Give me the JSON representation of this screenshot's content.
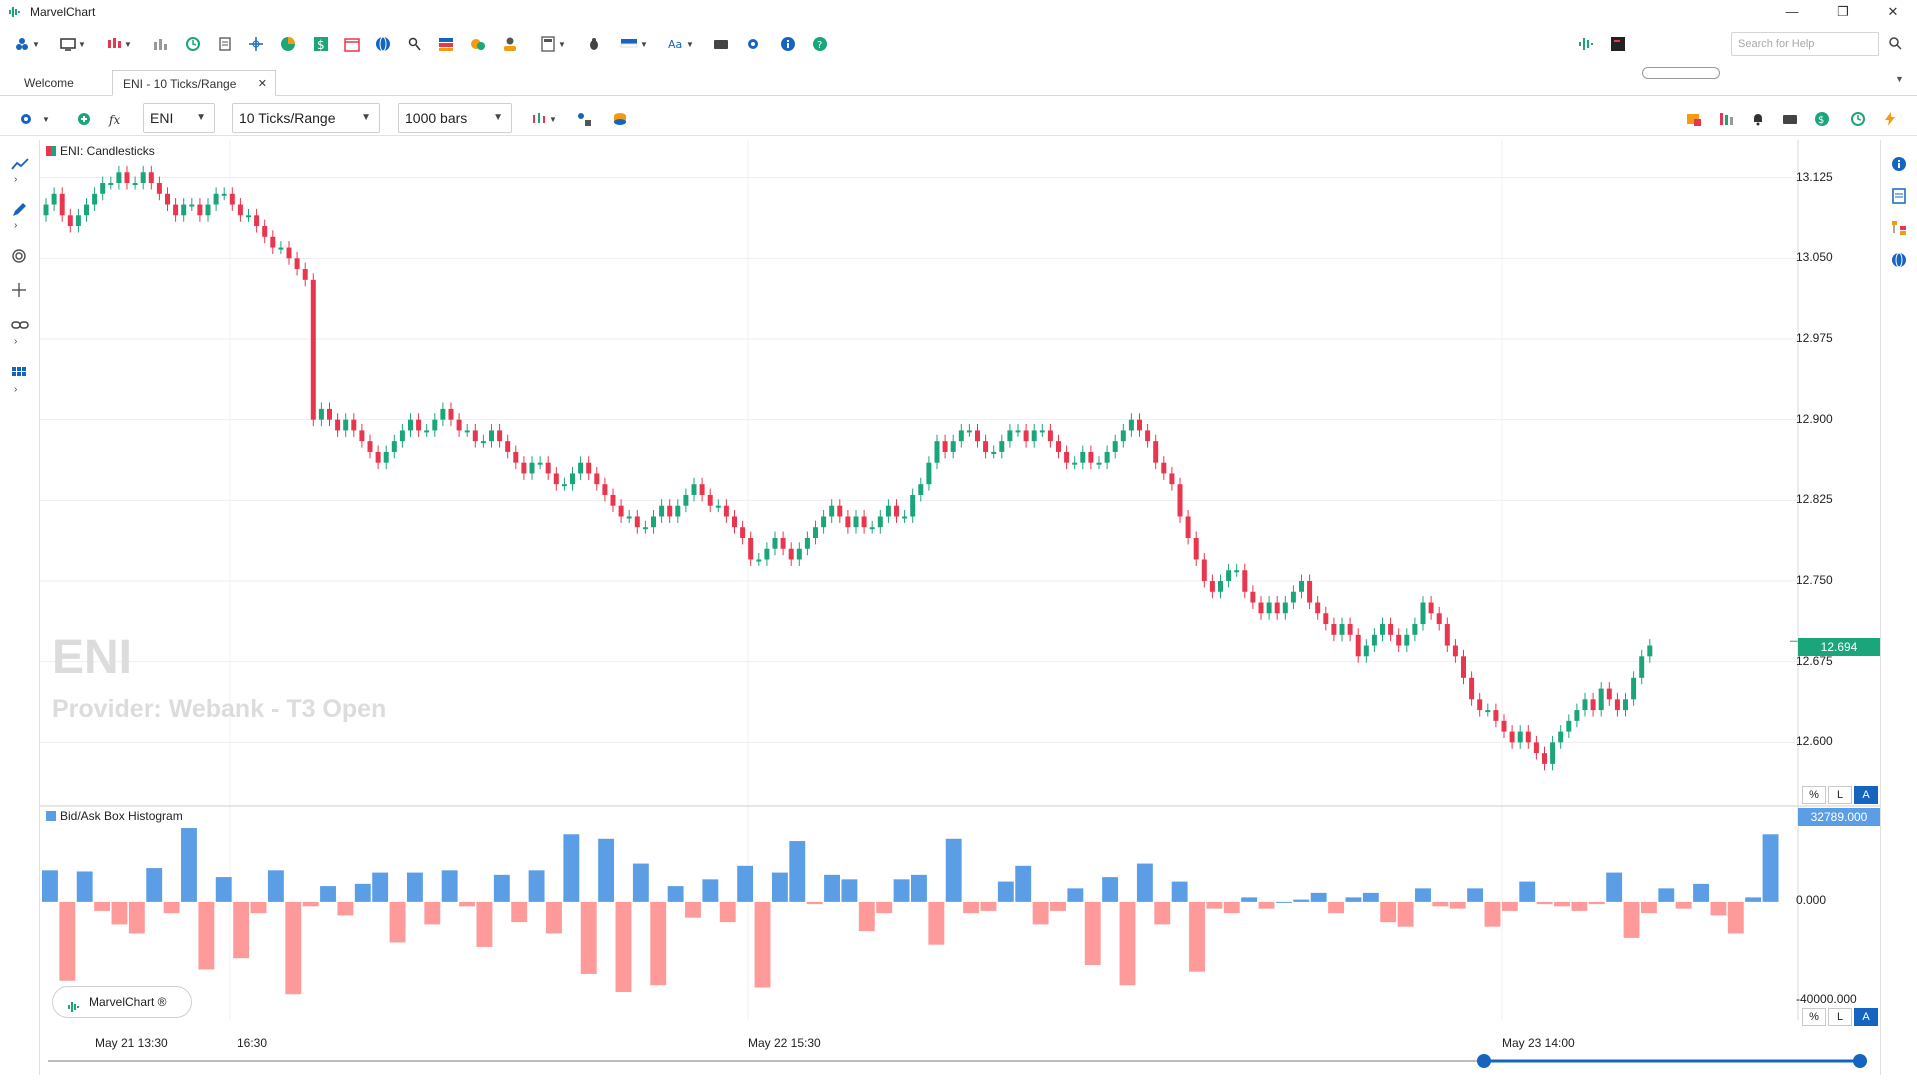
{
  "window": {
    "title": "MarvelChart",
    "minimize": "—",
    "maximize": "❐",
    "close": "✕"
  },
  "help_search": {
    "placeholder": "Search for Help"
  },
  "tabs": [
    {
      "label": "Welcome"
    },
    {
      "label": "ENI - 10 Ticks/Range",
      "close": "✕"
    }
  ],
  "chart_toolbar": {
    "symbol": "ENI",
    "period": "10 Ticks/Range",
    "bars": "1000 bars"
  },
  "price_panel": {
    "title": "ENI: Candlesticks",
    "watermark_symbol": "ENI",
    "watermark_provider": "Provider: Webank - T3 Open",
    "last_price": "12.694"
  },
  "price_axis": [
    "13.125",
    "13.050",
    "12.975",
    "12.900",
    "12.825",
    "12.750",
    "12.675",
    "12.600"
  ],
  "hist_panel": {
    "title": "Bid/Ask Box Histogram",
    "max_label": "32789.000",
    "zero_label": "0.000",
    "min_label": "-40000.000"
  },
  "scale_buttons": [
    "%",
    "L",
    "A"
  ],
  "time_axis": [
    "May 21 13:30",
    "16:30",
    "May 22 15:30",
    "May 23 14:00"
  ],
  "brand_badge": "MarvelChart ®",
  "colors": {
    "up": "#1ba57a",
    "down": "#e8364e",
    "hist_pos": "#5b9ee6",
    "hist_neg": "#ff9a9a",
    "accent": "#1565c0"
  },
  "chart_data": [
    {
      "type": "candlestick",
      "title": "ENI: Candlesticks",
      "y_ticks": [
        13.125,
        13.05,
        12.975,
        12.9,
        12.825,
        12.75,
        12.675,
        12.6
      ],
      "ylim": [
        12.565,
        13.16
      ],
      "last": 12.694,
      "closes": [
        13.1,
        13.11,
        13.09,
        13.08,
        13.09,
        13.1,
        13.11,
        13.12,
        13.12,
        13.13,
        13.12,
        13.12,
        13.13,
        13.12,
        13.11,
        13.1,
        13.09,
        13.1,
        13.1,
        13.09,
        13.1,
        13.11,
        13.11,
        13.1,
        13.09,
        13.09,
        13.08,
        13.07,
        13.06,
        13.06,
        13.05,
        13.04,
        13.03,
        12.9,
        12.91,
        12.9,
        12.89,
        12.9,
        12.89,
        12.88,
        12.87,
        12.86,
        12.87,
        12.88,
        12.89,
        12.9,
        12.89,
        12.89,
        12.9,
        12.91,
        12.9,
        12.89,
        12.89,
        12.88,
        12.88,
        12.89,
        12.88,
        12.87,
        12.86,
        12.85,
        12.86,
        12.86,
        12.85,
        12.84,
        12.84,
        12.85,
        12.86,
        12.85,
        12.84,
        12.83,
        12.82,
        12.81,
        12.81,
        12.8,
        12.8,
        12.81,
        12.82,
        12.81,
        12.82,
        12.83,
        12.84,
        12.83,
        12.82,
        12.82,
        12.81,
        12.8,
        12.79,
        12.77,
        12.77,
        12.78,
        12.79,
        12.78,
        12.77,
        12.78,
        12.79,
        12.8,
        12.81,
        12.82,
        12.81,
        12.8,
        12.81,
        12.8,
        12.8,
        12.81,
        12.82,
        12.81,
        12.81,
        12.83,
        12.84,
        12.86,
        12.88,
        12.87,
        12.88,
        12.89,
        12.89,
        12.88,
        12.87,
        12.87,
        12.88,
        12.89,
        12.89,
        12.88,
        12.89,
        12.89,
        12.88,
        12.87,
        12.86,
        12.86,
        12.87,
        12.86,
        12.86,
        12.87,
        12.88,
        12.89,
        12.9,
        12.89,
        12.88,
        12.86,
        12.85,
        12.84,
        12.81,
        12.79,
        12.77,
        12.75,
        12.74,
        12.75,
        12.76,
        12.76,
        12.74,
        12.73,
        12.72,
        12.73,
        12.72,
        12.73,
        12.74,
        12.75,
        12.73,
        12.72,
        12.71,
        12.7,
        12.71,
        12.7,
        12.68,
        12.69,
        12.7,
        12.71,
        12.7,
        12.69,
        12.7,
        12.71,
        12.73,
        12.72,
        12.71,
        12.69,
        12.68,
        12.66,
        12.64,
        12.63,
        12.63,
        12.62,
        12.61,
        12.6,
        12.61,
        12.6,
        12.59,
        12.58,
        12.6,
        12.61,
        12.62,
        12.63,
        12.64,
        12.63,
        12.65,
        12.64,
        12.63,
        12.64,
        12.66,
        12.68,
        12.69
      ]
    },
    {
      "type": "bar",
      "title": "Bid/Ask Box Histogram",
      "ylim": [
        -40000,
        32789
      ],
      "values": [
        14000,
        -35000,
        13500,
        -4000,
        -10000,
        -14000,
        15000,
        -5000,
        32789,
        -30000,
        11000,
        -25000,
        -5000,
        14000,
        -41000,
        -2000,
        7000,
        -6000,
        8000,
        13000,
        -18000,
        13000,
        -10000,
        14000,
        -2000,
        -20000,
        12000,
        -9000,
        14000,
        -14000,
        30000,
        -32000,
        28000,
        -40000,
        17000,
        -37000,
        7000,
        -7000,
        10000,
        -9000,
        16000,
        -38000,
        13000,
        27000,
        -1000,
        12000,
        10000,
        -13000,
        -5000,
        10000,
        12000,
        -19000,
        28000,
        -5000,
        -4000,
        9000,
        16000,
        -10000,
        -4000,
        6000,
        -28000,
        11000,
        -37000,
        17000,
        -10000,
        9000,
        -31000,
        -3000,
        -5000,
        2000,
        -3000,
        0,
        1000,
        4000,
        -5000,
        2000,
        4000,
        -9000,
        -11000,
        6000,
        -2000,
        -3000,
        6000,
        -11000,
        -4000,
        9000,
        -1000,
        -2000,
        -4000,
        -1000,
        13000,
        -16000,
        -5000,
        6000,
        -3000,
        8000,
        -6000,
        -14000,
        2000,
        30000
      ]
    }
  ]
}
